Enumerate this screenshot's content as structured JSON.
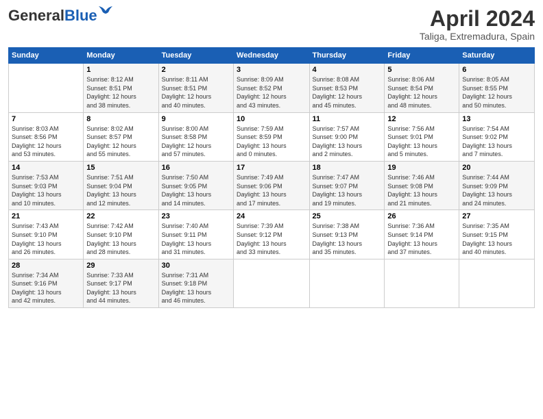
{
  "header": {
    "logo_line1": "General",
    "logo_line2": "Blue",
    "title": "April 2024",
    "subtitle": "Taliga, Extremadura, Spain"
  },
  "weekdays": [
    "Sunday",
    "Monday",
    "Tuesday",
    "Wednesday",
    "Thursday",
    "Friday",
    "Saturday"
  ],
  "weeks": [
    [
      {
        "day": "",
        "info": ""
      },
      {
        "day": "1",
        "info": "Sunrise: 8:12 AM\nSunset: 8:51 PM\nDaylight: 12 hours\nand 38 minutes."
      },
      {
        "day": "2",
        "info": "Sunrise: 8:11 AM\nSunset: 8:51 PM\nDaylight: 12 hours\nand 40 minutes."
      },
      {
        "day": "3",
        "info": "Sunrise: 8:09 AM\nSunset: 8:52 PM\nDaylight: 12 hours\nand 43 minutes."
      },
      {
        "day": "4",
        "info": "Sunrise: 8:08 AM\nSunset: 8:53 PM\nDaylight: 12 hours\nand 45 minutes."
      },
      {
        "day": "5",
        "info": "Sunrise: 8:06 AM\nSunset: 8:54 PM\nDaylight: 12 hours\nand 48 minutes."
      },
      {
        "day": "6",
        "info": "Sunrise: 8:05 AM\nSunset: 8:55 PM\nDaylight: 12 hours\nand 50 minutes."
      }
    ],
    [
      {
        "day": "7",
        "info": "Sunrise: 8:03 AM\nSunset: 8:56 PM\nDaylight: 12 hours\nand 53 minutes."
      },
      {
        "day": "8",
        "info": "Sunrise: 8:02 AM\nSunset: 8:57 PM\nDaylight: 12 hours\nand 55 minutes."
      },
      {
        "day": "9",
        "info": "Sunrise: 8:00 AM\nSunset: 8:58 PM\nDaylight: 12 hours\nand 57 minutes."
      },
      {
        "day": "10",
        "info": "Sunrise: 7:59 AM\nSunset: 8:59 PM\nDaylight: 13 hours\nand 0 minutes."
      },
      {
        "day": "11",
        "info": "Sunrise: 7:57 AM\nSunset: 9:00 PM\nDaylight: 13 hours\nand 2 minutes."
      },
      {
        "day": "12",
        "info": "Sunrise: 7:56 AM\nSunset: 9:01 PM\nDaylight: 13 hours\nand 5 minutes."
      },
      {
        "day": "13",
        "info": "Sunrise: 7:54 AM\nSunset: 9:02 PM\nDaylight: 13 hours\nand 7 minutes."
      }
    ],
    [
      {
        "day": "14",
        "info": "Sunrise: 7:53 AM\nSunset: 9:03 PM\nDaylight: 13 hours\nand 10 minutes."
      },
      {
        "day": "15",
        "info": "Sunrise: 7:51 AM\nSunset: 9:04 PM\nDaylight: 13 hours\nand 12 minutes."
      },
      {
        "day": "16",
        "info": "Sunrise: 7:50 AM\nSunset: 9:05 PM\nDaylight: 13 hours\nand 14 minutes."
      },
      {
        "day": "17",
        "info": "Sunrise: 7:49 AM\nSunset: 9:06 PM\nDaylight: 13 hours\nand 17 minutes."
      },
      {
        "day": "18",
        "info": "Sunrise: 7:47 AM\nSunset: 9:07 PM\nDaylight: 13 hours\nand 19 minutes."
      },
      {
        "day": "19",
        "info": "Sunrise: 7:46 AM\nSunset: 9:08 PM\nDaylight: 13 hours\nand 21 minutes."
      },
      {
        "day": "20",
        "info": "Sunrise: 7:44 AM\nSunset: 9:09 PM\nDaylight: 13 hours\nand 24 minutes."
      }
    ],
    [
      {
        "day": "21",
        "info": "Sunrise: 7:43 AM\nSunset: 9:10 PM\nDaylight: 13 hours\nand 26 minutes."
      },
      {
        "day": "22",
        "info": "Sunrise: 7:42 AM\nSunset: 9:10 PM\nDaylight: 13 hours\nand 28 minutes."
      },
      {
        "day": "23",
        "info": "Sunrise: 7:40 AM\nSunset: 9:11 PM\nDaylight: 13 hours\nand 31 minutes."
      },
      {
        "day": "24",
        "info": "Sunrise: 7:39 AM\nSunset: 9:12 PM\nDaylight: 13 hours\nand 33 minutes."
      },
      {
        "day": "25",
        "info": "Sunrise: 7:38 AM\nSunset: 9:13 PM\nDaylight: 13 hours\nand 35 minutes."
      },
      {
        "day": "26",
        "info": "Sunrise: 7:36 AM\nSunset: 9:14 PM\nDaylight: 13 hours\nand 37 minutes."
      },
      {
        "day": "27",
        "info": "Sunrise: 7:35 AM\nSunset: 9:15 PM\nDaylight: 13 hours\nand 40 minutes."
      }
    ],
    [
      {
        "day": "28",
        "info": "Sunrise: 7:34 AM\nSunset: 9:16 PM\nDaylight: 13 hours\nand 42 minutes."
      },
      {
        "day": "29",
        "info": "Sunrise: 7:33 AM\nSunset: 9:17 PM\nDaylight: 13 hours\nand 44 minutes."
      },
      {
        "day": "30",
        "info": "Sunrise: 7:31 AM\nSunset: 9:18 PM\nDaylight: 13 hours\nand 46 minutes."
      },
      {
        "day": "",
        "info": ""
      },
      {
        "day": "",
        "info": ""
      },
      {
        "day": "",
        "info": ""
      },
      {
        "day": "",
        "info": ""
      }
    ]
  ]
}
